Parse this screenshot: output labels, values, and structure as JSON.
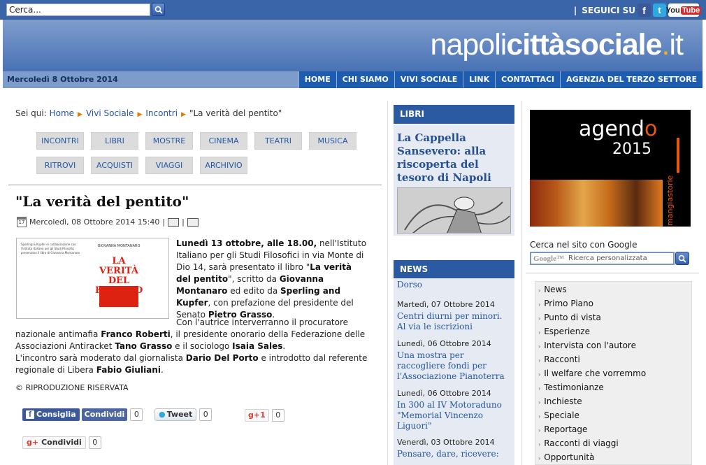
{
  "topbar": {
    "search_value": "Cerca...",
    "follow_label": "SEGUICI SU",
    "social_icons": [
      "facebook-icon",
      "twitter-icon",
      "youtube-icon"
    ],
    "youtube_you": "You",
    "youtube_tube": "Tube"
  },
  "header": {
    "logo_part1": "napoli",
    "logo_part2": "cittàsociale",
    "logo_dot": ".",
    "logo_part3": "it",
    "date": "Mercoledì 8 Ottobre 2014",
    "nav": [
      "HOME",
      "CHI SIAMO",
      "VIVI SOCIALE",
      "LINK",
      "CONTATTACI",
      "AGENZIA DEL TERZO SETTORE"
    ]
  },
  "breadcrumb": {
    "prefix": "Sei qui:",
    "items": [
      "Home",
      "Vivi Sociale",
      "Incontri"
    ],
    "current": "\"La verità del pentito\""
  },
  "subnav": [
    "INCONTRI",
    "LIBRI",
    "MOSTRE",
    "CINEMA",
    "TEATRI",
    "MUSICA",
    "RITROVI",
    "ACQUISTI",
    "VIAGGI",
    "ARCHIVIO"
  ],
  "article": {
    "title": "\"La verità del pentito\"",
    "date": "Mercoledì, 08 Ottobre 2014 15:40",
    "meta_sep": "|",
    "calendar_day": "17",
    "p1": {
      "a": "Lunedì 13 ottobre, alle 18.00,",
      "b": " nell'Istituto Italiano per gli Studi Filosofici in via Monte di Dio 14, sarà presentato il libro \"",
      "c": "La verità del pentito",
      "d": "\", scritto da ",
      "e": "Giovanna Montanaro",
      "f": " ed edito da ",
      "g": "Sperling and Kupfer",
      "h": ", con prefazione del presidente del Senato ",
      "i": "Pietro Grasso",
      "j": "."
    },
    "p2": {
      "a": "Con l'autrice interverranno il procuratore nazionale antimafia ",
      "b": "Franco Roberti",
      "c": ", il presidente onorario della Federazione delle Associazioni Antiracket ",
      "d": "Tano Grasso",
      "e": " e il sociologo ",
      "f": "Isaia Sales",
      "g": "."
    },
    "p3": {
      "a": "L'incontro sarà moderato dal giornalista ",
      "b": "Dario Del Porto",
      "c": " e introdotto dal referente regionale di Libera ",
      "d": "Fabio Giuliani",
      "e": "."
    },
    "copyright": "© RIPRODUZIONE RISERVATA",
    "poster": {
      "lines": "Sperling & Kupfer in collaborazione con l'Istituto Italiano per gli Studi Filosofici presentano il libro di Giovanna Montanaro",
      "author": "GIOVANNA MONTANARO",
      "title": "LA VERITÀ DEL PENTITO"
    }
  },
  "share": {
    "fb_label": "Consiglia",
    "fb_share": "Condividi",
    "fb_count": "0",
    "tw_label": "Tweet",
    "tw_count": "0",
    "gplus_label": "g+1",
    "gplus_count": "0",
    "gshare_g": "g+",
    "gshare_label": "Condividi",
    "gshare_count": "0"
  },
  "libri": {
    "heading": "LIBRI",
    "title": "La Cappella Sansevero: alla riscoperta del tesoro di Napoli"
  },
  "news": {
    "heading": "NEWS",
    "partial": "Dorso",
    "items": [
      {
        "date": "Martedì, 07 Ottobre 2014",
        "title": "Centri diurni per minori. Al via le iscrizioni"
      },
      {
        "date": "Lunedì, 06 Ottobre 2014",
        "title": "Una mostra per raccogliere fondi per l'Associazione Pianoterra"
      },
      {
        "date": "Lunedì, 06 Ottobre 2014",
        "title": "In 300 al IV Motoraduno \"Memorial Vincenzo Liguori\""
      },
      {
        "date": "Venerdì, 03 Ottobre 2014",
        "title": "Pensare, dare, ricevere:"
      }
    ]
  },
  "agenda": {
    "word_a": "agend",
    "word_o": "o",
    "year": "2015",
    "brand": "mangiastorie"
  },
  "gsearch": {
    "label": "Cerca nel sito con Google",
    "google": "Google™",
    "placeholder": "Ricerca personalizzata"
  },
  "categories": [
    "News",
    "Primo Piano",
    "Punto di vista",
    "Esperienze",
    "Intervista con l'autore",
    "Racconti",
    "Il welfare che vorremmo",
    "Testimonianze",
    "Inchieste",
    "Speciale",
    "Reportage",
    "Racconti di viaggi",
    "Opportunità"
  ],
  "colors": {
    "topbar": "#3a66a9",
    "nav": "#1d5cae",
    "link": "#2457a4",
    "accent": "#e07a00"
  }
}
